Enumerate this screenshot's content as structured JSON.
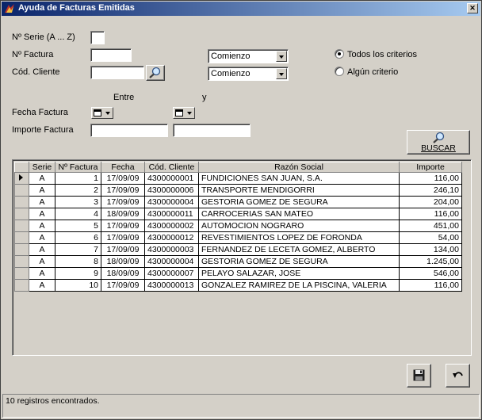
{
  "window": {
    "title": "Ayuda de Facturas Emitidas",
    "close_label": "✕"
  },
  "filters": {
    "serie_label": "Nº Serie (A ... Z)",
    "serie_value": "",
    "factura_label": "Nº Factura",
    "factura_value": "",
    "factura_match": "Comienzo",
    "cliente_label": "Cód. Cliente",
    "cliente_value": "",
    "cliente_match": "Comienzo",
    "entre_label": "Entre",
    "y_label": "y",
    "fecha_label": "Fecha Factura",
    "importe_label": "Importe Factura",
    "importe_from": "",
    "importe_to": ""
  },
  "criteria": {
    "todos_label": "Todos los criterios",
    "algun_label": "Algún criterio",
    "selected": "todos"
  },
  "buscar_label": "BUSCAR",
  "table": {
    "columns": [
      "Serie",
      "Nº Factura",
      "Fecha",
      "Cód. Cliente",
      "Razón Social",
      "Importe"
    ],
    "rows": [
      [
        "A",
        "1",
        "17/09/09",
        "4300000001",
        "FUNDICIONES SAN JUAN, S.A.",
        "116,00"
      ],
      [
        "A",
        "2",
        "17/09/09",
        "4300000006",
        "TRANSPORTE MENDIGORRI",
        "246,10"
      ],
      [
        "A",
        "3",
        "17/09/09",
        "4300000004",
        "GESTORIA GOMEZ DE SEGURA",
        "204,00"
      ],
      [
        "A",
        "4",
        "18/09/09",
        "4300000011",
        "CARROCERIAS SAN MATEO",
        "116,00"
      ],
      [
        "A",
        "5",
        "17/09/09",
        "4300000002",
        "AUTOMOCION NOGRARO",
        "451,00"
      ],
      [
        "A",
        "6",
        "17/09/09",
        "4300000012",
        "REVESTIMIENTOS LOPEZ DE FORONDA",
        "54,00"
      ],
      [
        "A",
        "7",
        "17/09/09",
        "4300000003",
        "FERNANDEZ DE LECETA GOMEZ, ALBERTO",
        "134,00"
      ],
      [
        "A",
        "8",
        "18/09/09",
        "4300000004",
        "GESTORIA GOMEZ DE SEGURA",
        "1.245,00"
      ],
      [
        "A",
        "9",
        "18/09/09",
        "4300000007",
        "PELAYO SALAZAR, JOSE",
        "546,00"
      ],
      [
        "A",
        "10",
        "17/09/09",
        "4300000013",
        "GONZALEZ RAMIREZ DE LA PISCINA, VALERIA",
        "116,00"
      ]
    ],
    "current_row": 0
  },
  "status": {
    "text": "10 registros encontrados."
  },
  "icons": {
    "app": "app-icon",
    "search": "magnifier-icon",
    "save": "floppy-disk-icon",
    "undo": "undo-arrow-icon"
  }
}
